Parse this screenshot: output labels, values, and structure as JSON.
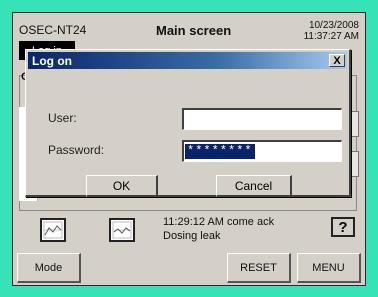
{
  "header": {
    "device_id": "OSEC-NT24",
    "login_label": "Log in",
    "title": "Main screen",
    "date": "10/23/2008",
    "time": "11:37:27 AM"
  },
  "background_panel": {
    "label": "Cu"
  },
  "dialog": {
    "title": "Log on",
    "close_label": "X",
    "user_label": "User:",
    "user_value": "",
    "password_label": "Password:",
    "password_value": "********",
    "ok_label": "OK",
    "cancel_label": "Cancel"
  },
  "alarm": {
    "line1": "11:29:12 AM  come  ack",
    "line2": "Dosing leak"
  },
  "help_glyph": "?",
  "footer": {
    "mode_label": "Mode",
    "reset_label": "RESET",
    "menu_label": "MENU"
  },
  "colors": {
    "bezel": "#35e3b7",
    "title_bar": "#0a246a",
    "selection": "#0a246a"
  },
  "icons": [
    "graph-icon",
    "help-icon",
    "close-icon"
  ]
}
